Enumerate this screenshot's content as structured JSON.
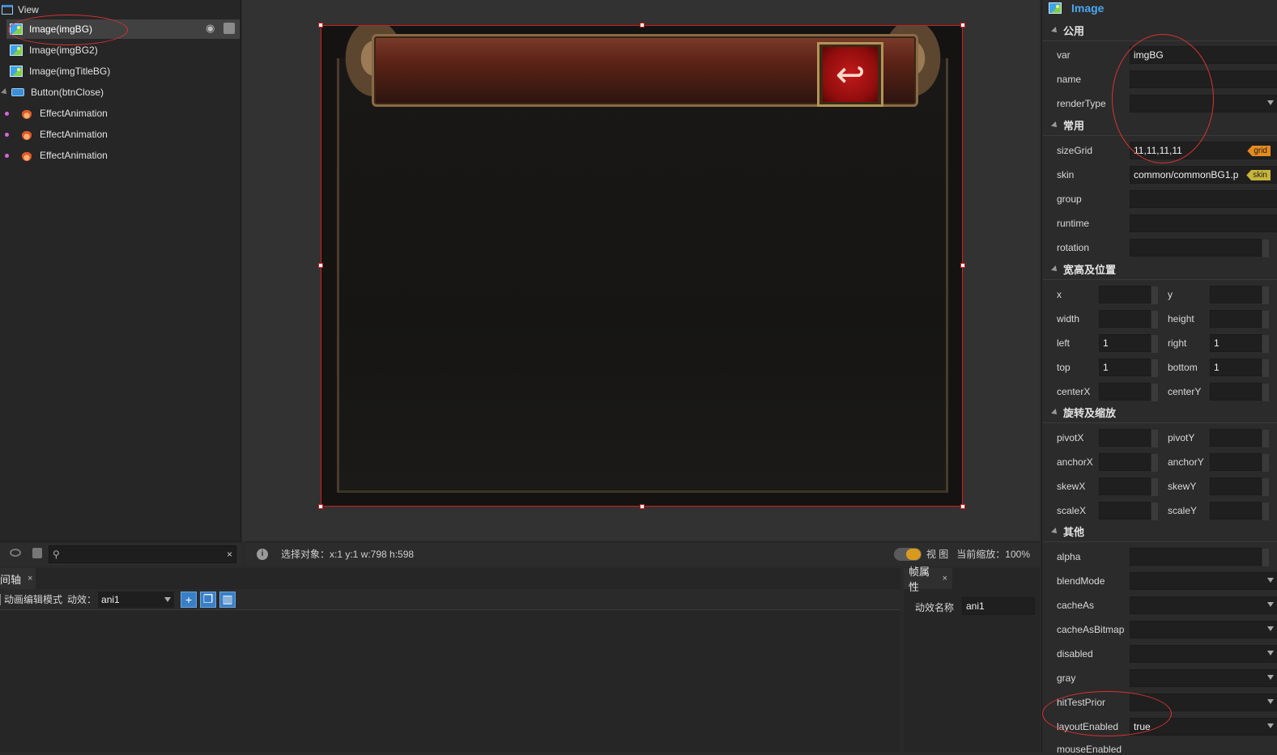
{
  "tree": {
    "root": "View",
    "items": [
      {
        "label": "Image(imgBG)",
        "icon": "image-icon"
      },
      {
        "label": "Image(imgBG2)",
        "icon": "image-icon"
      },
      {
        "label": "Image(imgTitleBG)",
        "icon": "image-icon"
      },
      {
        "label": "Button(btnClose)",
        "icon": "button-icon"
      },
      {
        "label": "EffectAnimation",
        "icon": "fire-icon"
      },
      {
        "label": "EffectAnimation",
        "icon": "fire-icon"
      },
      {
        "label": "EffectAnimation",
        "icon": "fire-icon"
      }
    ],
    "footer_search_clear": "×"
  },
  "status": {
    "selection_label": "选择对象：x:1 y:1  w:798 h:598",
    "view_label": "视 图",
    "zoom_label": "当前缩放：100%"
  },
  "timeline": {
    "tab_label": "间轴",
    "mode_label": "动画编辑模式",
    "effect_label": "动效：",
    "effect_value": "ani1"
  },
  "frameprops": {
    "tab_label": "帧属性",
    "name_label": "动效名称",
    "name_value": "ani1"
  },
  "props": {
    "title": "Image",
    "sections": {
      "common_public": "公用",
      "common": "常用",
      "size_pos": "宽高及位置",
      "rot_scale": "旋转及缩放",
      "other": "其他"
    },
    "var_label": "var",
    "var_value": "imgBG",
    "name_label": "name",
    "renderType_label": "renderType",
    "sizeGrid_label": "sizeGrid",
    "sizeGrid_value": "11,11,11,11",
    "sizeGrid_tag": "grid",
    "skin_label": "skin",
    "skin_value": "common/commonBG1.p",
    "skin_tag": "skin",
    "group_label": "group",
    "runtime_label": "runtime",
    "rotation_label": "rotation",
    "x_label": "x",
    "y_label": "y",
    "width_label": "width",
    "height_label": "height",
    "left_label": "left",
    "left_value": "1",
    "right_label": "right",
    "right_value": "1",
    "top_label": "top",
    "top_value": "1",
    "bottom_label": "bottom",
    "bottom_value": "1",
    "centerX_label": "centerX",
    "centerY_label": "centerY",
    "pivotX_label": "pivotX",
    "pivotY_label": "pivotY",
    "anchorX_label": "anchorX",
    "anchorY_label": "anchorY",
    "skewX_label": "skewX",
    "skewY_label": "skewY",
    "scaleX_label": "scaleX",
    "scaleY_label": "scaleY",
    "alpha_label": "alpha",
    "blendMode_label": "blendMode",
    "cacheAs_label": "cacheAs",
    "cacheAsBitmap_label": "cacheAsBitmap",
    "disabled_label": "disabled",
    "gray_label": "gray",
    "hitTestPrior_label": "hitTestPrior",
    "layoutEnabled_label": "layoutEnabled",
    "layoutEnabled_value": "true",
    "mouseEnabled_label": "mouseEnabled"
  },
  "colors": {
    "accent_blue": "#3fa3e9",
    "selection_red": "#d31c1c",
    "toggle_orange": "#d89a1e"
  }
}
